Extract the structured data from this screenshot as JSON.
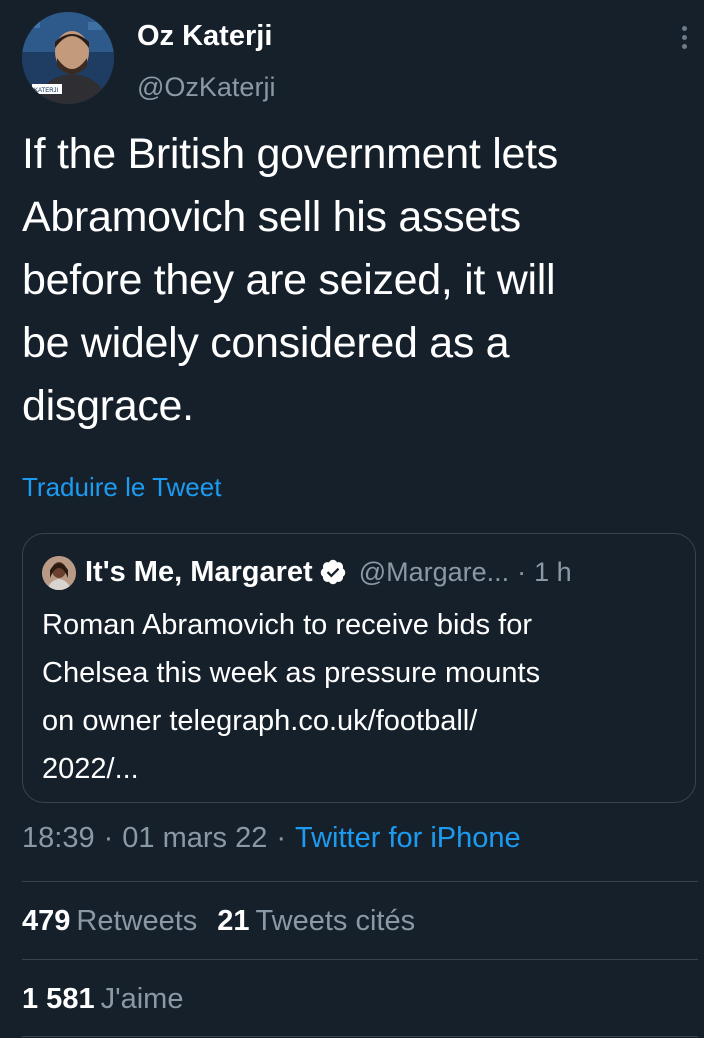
{
  "author": {
    "display_name": "Oz Katerji",
    "handle": "@OzKaterji",
    "avatar_badge_text": "KATERJI"
  },
  "more_icon": "more-vertical-icon",
  "tweet": {
    "text_lines": [
      "If the British government lets",
      "Abramovich sell his assets",
      "before they are seized, it will",
      "be widely considered as a",
      "disgrace."
    ],
    "translate_label": "Traduire le Tweet"
  },
  "quote": {
    "display_name": "It's Me, Margaret",
    "verified_icon": "verified-badge-icon",
    "handle": "@Margare...",
    "dot": "·",
    "time": "1 h",
    "text_lines": [
      "Roman Abramovich to receive bids for",
      "Chelsea this week as pressure mounts",
      "on owner telegraph.co.uk/football/",
      "2022/..."
    ]
  },
  "meta": {
    "time": "18:39",
    "sep": "·",
    "date": "01 mars 22",
    "source": "Twitter for iPhone"
  },
  "stats": {
    "retweets_count": "479",
    "retweets_label": "Retweets",
    "quotes_count": "21",
    "quotes_label": "Tweets cités",
    "likes_count": "1 581",
    "likes_label": "J'aime"
  },
  "colors": {
    "background": "#15202b",
    "text": "#ffffff",
    "secondary": "#8b98a5",
    "link": "#1d9bf0",
    "border": "#38444d"
  }
}
